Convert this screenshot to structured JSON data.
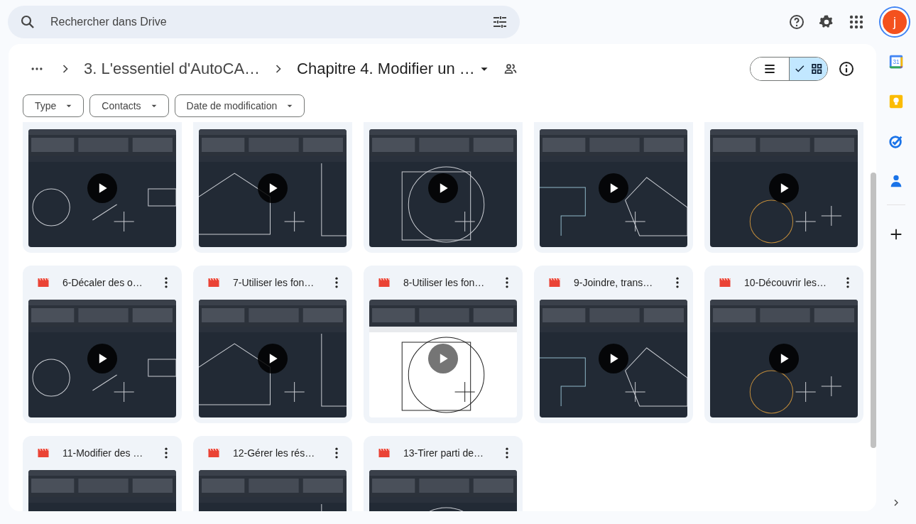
{
  "search": {
    "placeholder": "Rechercher dans Drive"
  },
  "account": {
    "initial": "j"
  },
  "breadcrumb": [
    {
      "label": "3. L'essentiel d'AutoCA…",
      "current": false
    },
    {
      "label": "Chapitre 4. Modifier un …",
      "current": true
    }
  ],
  "view_toggle": [
    {
      "kind": "list",
      "selected": false
    },
    {
      "kind": "grid",
      "selected": true
    }
  ],
  "filters": [
    "Type",
    "Contacts",
    "Date de modification"
  ],
  "files": [
    {
      "kind": "video"
    },
    {
      "kind": "video"
    },
    {
      "kind": "video"
    },
    {
      "kind": "video"
    },
    {
      "kind": "video"
    },
    {
      "kind": "video",
      "title": "6-Décaler des o…"
    },
    {
      "kind": "video",
      "title": "7-Utiliser les fon…"
    },
    {
      "kind": "video",
      "title": "8-Utiliser les fon…"
    },
    {
      "kind": "video",
      "title": "9-Joindre, trans…"
    },
    {
      "kind": "video",
      "title": "10-Découvrir les…"
    },
    {
      "kind": "video",
      "title": "11-Modifier des …"
    },
    {
      "kind": "video",
      "title": "12-Gérer les rés…"
    },
    {
      "kind": "video",
      "title": "13-Tirer parti de…"
    }
  ],
  "side_rail": {
    "calendar_day": "31"
  }
}
